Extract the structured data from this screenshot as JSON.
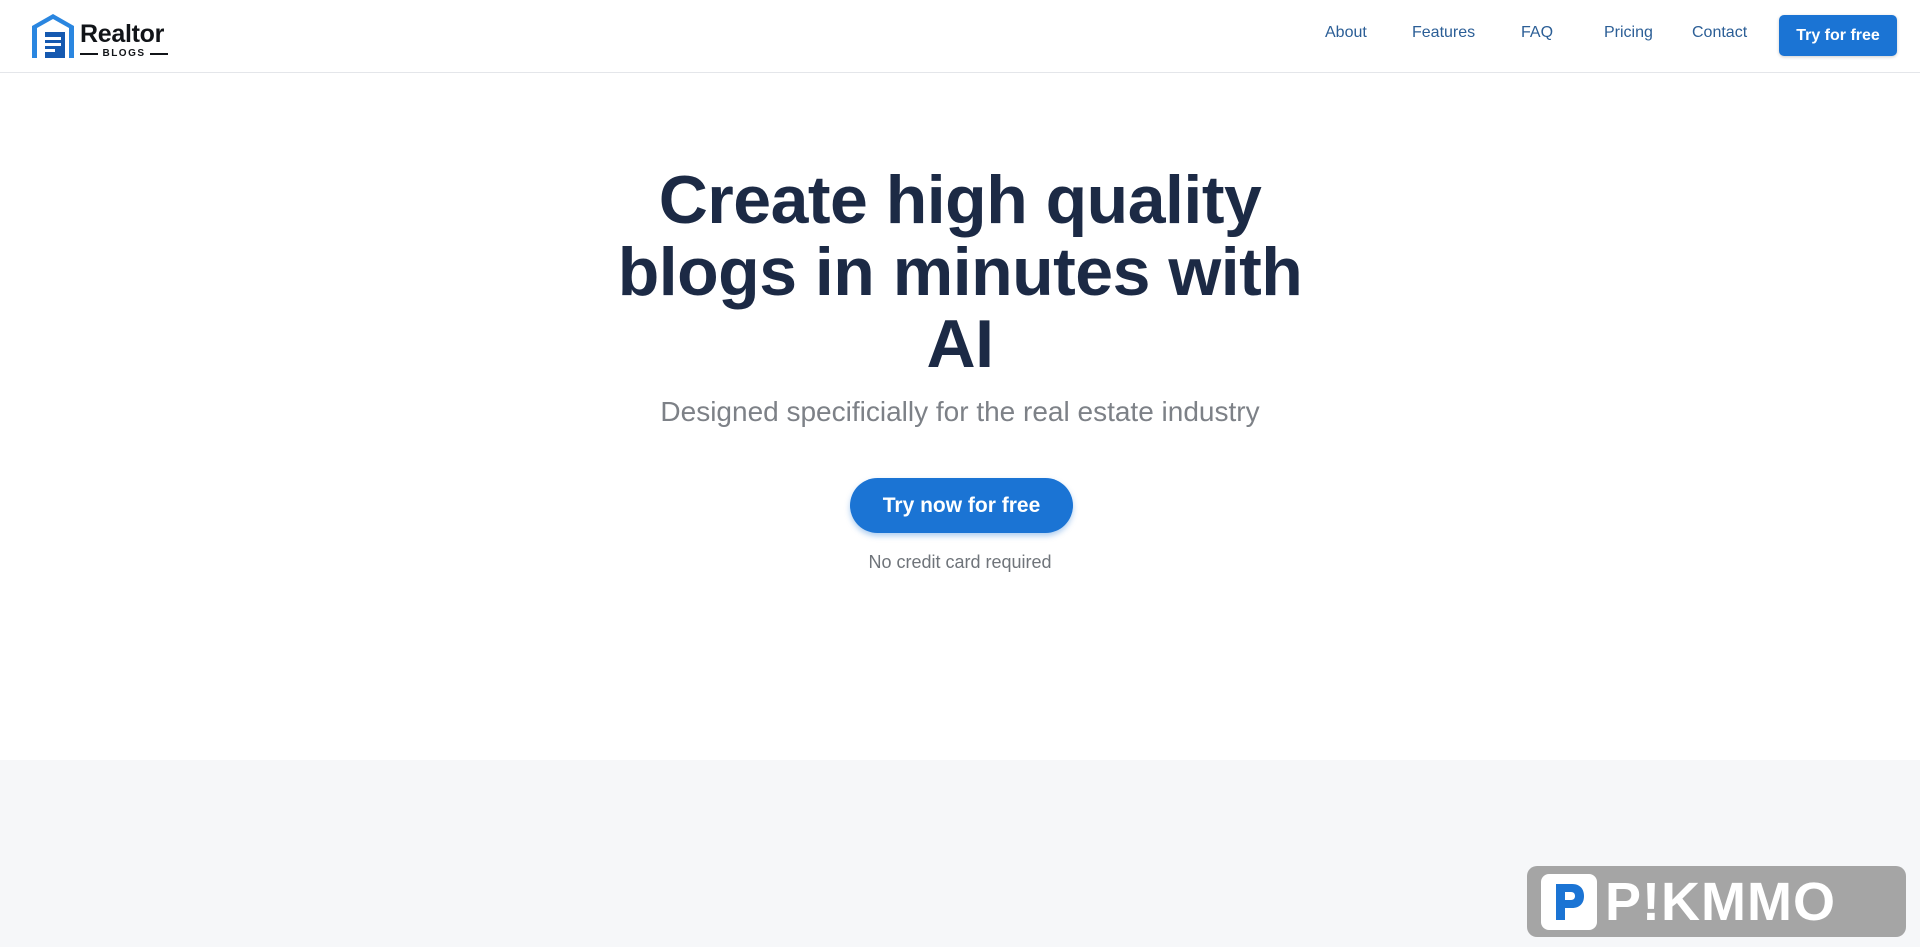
{
  "header": {
    "logo": {
      "word": "Realtor",
      "sub": "BLOGS"
    },
    "nav": [
      {
        "label": "About"
      },
      {
        "label": "Features"
      },
      {
        "label": "FAQ"
      },
      {
        "label": "Pricing"
      },
      {
        "label": "Contact"
      }
    ],
    "cta_label": "Try for free"
  },
  "hero": {
    "title_line1": "Create high quality",
    "title_line2": "blogs in minutes with",
    "title_line3": "AI",
    "subtitle": "Designed specificially for the real estate industry",
    "cta_label": "Try now for free",
    "note": "No credit card required"
  },
  "watermark": {
    "text": "P!KMMO"
  },
  "colors": {
    "brand_blue": "#1b74d4",
    "nav_link": "#2b5e96",
    "title": "#1c2a45",
    "muted": "#7d8187",
    "section_bg": "#f6f7f9"
  }
}
